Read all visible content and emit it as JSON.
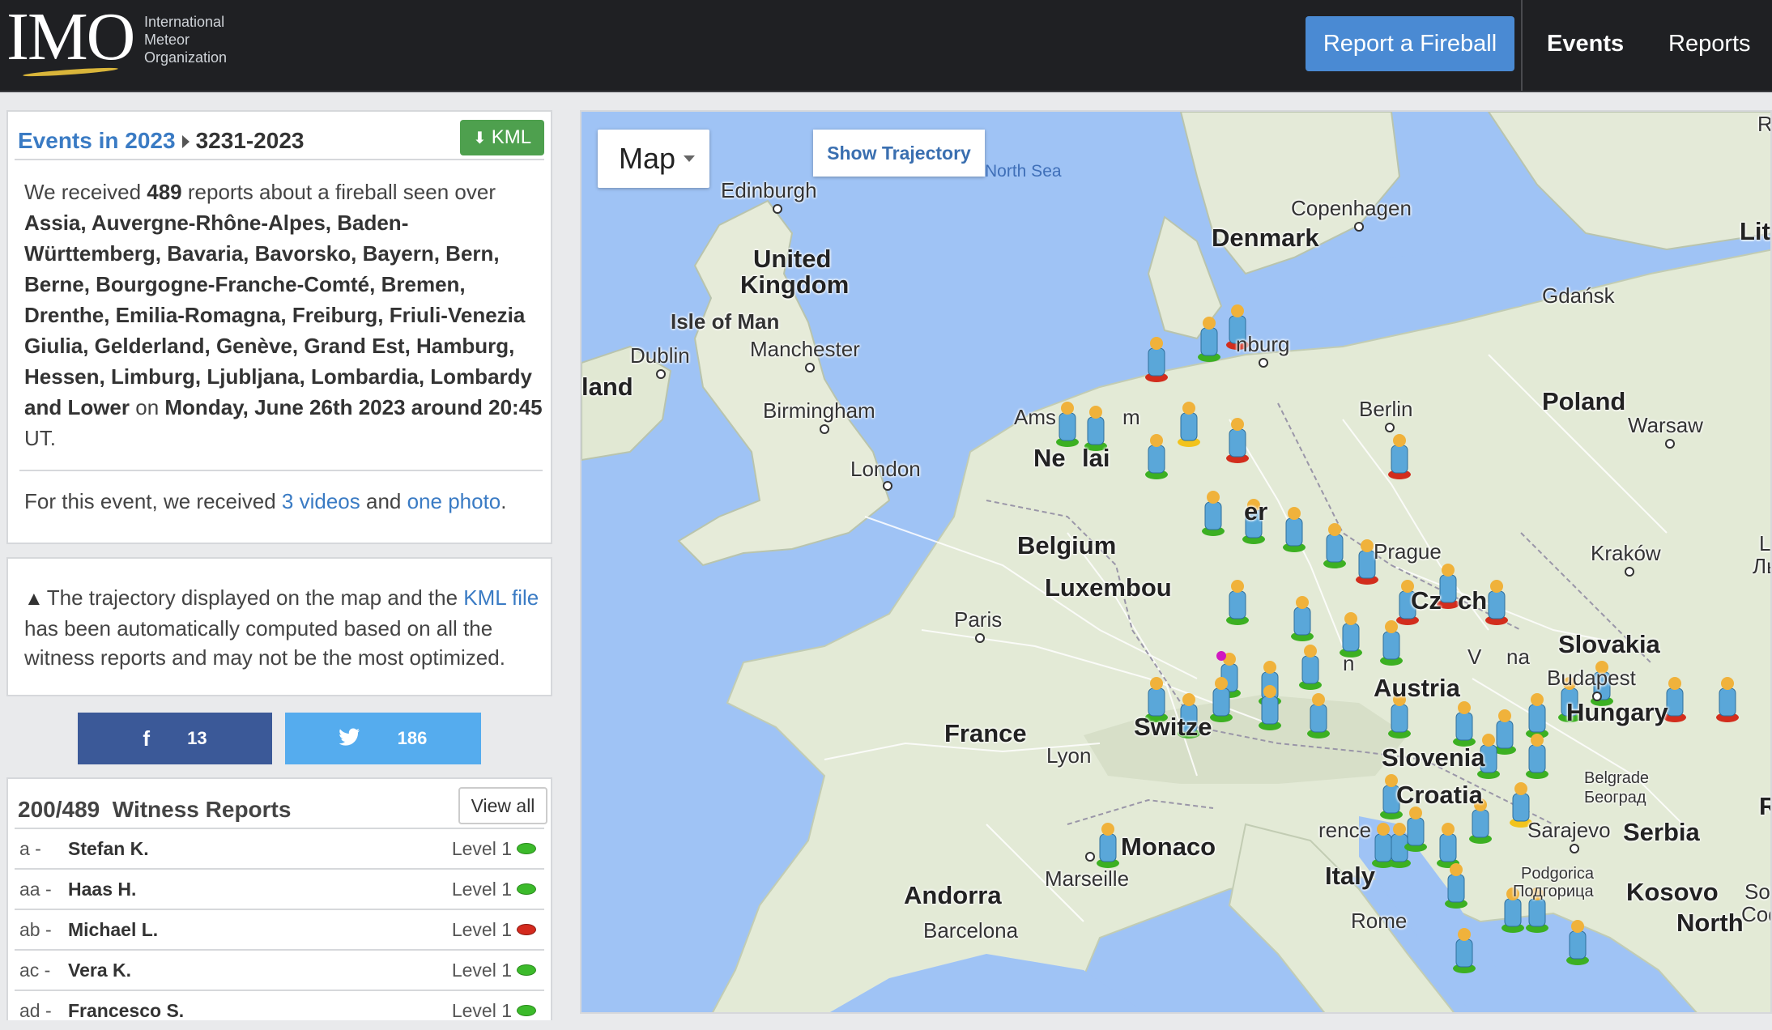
{
  "header": {
    "logo_mark": "IMO",
    "logo_lines": [
      "International",
      "Meteor",
      "Organization"
    ],
    "report_button": "Report a Fireball",
    "nav_events": "Events",
    "nav_reports": "Reports"
  },
  "event": {
    "breadcrumb_parent": "Events in 2023",
    "breadcrumb_current": "3231-2023",
    "kml_label": "KML",
    "desc_prefix": "We received ",
    "report_count": "489",
    "desc_mid": " reports about a fireball seen over ",
    "regions": "Assia, Auvergne-Rhône-Alpes, Baden-Württemberg, Bavaria, Bavorsko, Bayern, Bern, Berne, Bourgogne-Franche-Comté, Bremen, Drenthe, Emilia-Romagna, Freiburg, Friuli-Venezia Giulia, Gelderland, Genève, Grand Est, Hamburg, Hessen, Limburg, Ljubljana, Lombardia, Lombardy and Lower",
    "desc_on": " on ",
    "datetime": "Monday, June 26th 2023 around 20:45",
    "desc_end": " UT.",
    "media_prefix": "For this event, we received ",
    "videos_link": "3 videos",
    "media_and": " and ",
    "photo_link": "one photo",
    "media_end": "."
  },
  "warning": {
    "pre": "The trajectory displayed on the map and the ",
    "link": "KML file",
    "post": " has been automatically computed based on all the witness reports and may not be the most optimized."
  },
  "social": {
    "facebook_count": "13",
    "twitter_count": "186"
  },
  "witness": {
    "title": "200/489  Witness Reports",
    "view_all": "View all",
    "rows": [
      {
        "id": "a -",
        "name": "Stefan K.",
        "level": "Level 1",
        "status": "green"
      },
      {
        "id": "aa -",
        "name": "Haas H.",
        "level": "Level 1",
        "status": "green"
      },
      {
        "id": "ab -",
        "name": "Michael L.",
        "level": "Level 1",
        "status": "red"
      },
      {
        "id": "ac -",
        "name": "Vera K.",
        "level": "Level 1",
        "status": "green"
      },
      {
        "id": "ad -",
        "name": "Francesco S.",
        "level": "Level 1",
        "status": "green"
      }
    ]
  },
  "map": {
    "type_button": "Map",
    "trajectory_button": "Show Trajectory",
    "labels": {
      "north_sea": "North Sea",
      "edinburgh": "Edinburgh",
      "copenhagen": "Copenhagen",
      "denmark": "Denmark",
      "united": "United",
      "kingdom": "Kingdom",
      "isle_of_man": "Isle of Man",
      "dublin": "Dublin",
      "ireland": "land",
      "manchester": "Manchester",
      "birmingham": "Birmingham",
      "london": "London",
      "amsterdam_a": "Ams",
      "amsterdam_b": "m",
      "netherlands_a": "Ne",
      "netherlands_b": "lai",
      "hamburg": "nburg",
      "gdansk": "Gdańsk",
      "berlin": "Berlin",
      "poland": "Poland",
      "warsaw": "Warsaw",
      "belgium": "Belgium",
      "luxembourg": "Luxembou",
      "germany_frag": "er",
      "prague": "Prague",
      "krakow": "Kraków",
      "czech": "Cz",
      "czech_b": "ch",
      "paris": "Paris",
      "vienna_a": "V",
      "vienna_b": "na",
      "slovakia": "Slovakia",
      "budapest": "Budapest",
      "austria": "Austria",
      "hungary": "Hungary",
      "france": "France",
      "switzerland": "Switze",
      "munich_frag": "n",
      "lyon": "Lyon",
      "slovenia": "Slovenia",
      "croatia": "Croatia",
      "belgrade": "Belgrade",
      "belgrade_cyr": "Београд",
      "sarajevo": "Sarajevo",
      "serbia": "Serbia",
      "monaco": "Monaco",
      "florence": "rence",
      "marseille": "Marseille",
      "italy": "Italy",
      "podgorica": "Podgorica",
      "podgorica_cyr": "Подгорица",
      "kosovo": "Kosovo",
      "andorra": "Andorra",
      "barcelona": "Barcelona",
      "rome": "Rome",
      "north": "North",
      "edge_r": "R",
      "lithuania": "Lithu",
      "edge_l": "L",
      "edge_lb": "Ль",
      "edge_r2": "R",
      "sofia": "Sofi",
      "sofia_cyr": "Софи"
    }
  }
}
